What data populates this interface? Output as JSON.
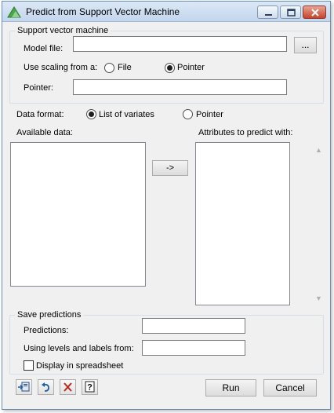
{
  "window": {
    "title": "Predict from Support Vector Machine"
  },
  "svm_group": {
    "legend": "Support vector machine",
    "model_file_label": "Model file:",
    "model_file_value": "",
    "browse_label": "...",
    "scaling_label": "Use scaling from a:",
    "scaling_options": [
      "File",
      "Pointer"
    ],
    "scaling_selected": "Pointer",
    "pointer_label": "Pointer:",
    "pointer_value": ""
  },
  "data_format": {
    "label": "Data format:",
    "options": [
      "List of variates",
      "Pointer"
    ],
    "selected": "List of variates"
  },
  "available_data": {
    "label": "Available data:",
    "items": []
  },
  "transfer_button": "->",
  "attributes": {
    "label": "Attributes to predict with:",
    "items": []
  },
  "save_group": {
    "legend": "Save predictions",
    "predictions_label": "Predictions:",
    "predictions_value": "",
    "levels_label": "Using levels and labels from:",
    "levels_value": "",
    "spreadsheet_label": "Display in spreadsheet",
    "spreadsheet_checked": false
  },
  "toolbar": {
    "icons": [
      "output-to-window-icon",
      "undo-icon",
      "clear-icon",
      "help-icon"
    ],
    "run_label": "Run",
    "cancel_label": "Cancel"
  }
}
